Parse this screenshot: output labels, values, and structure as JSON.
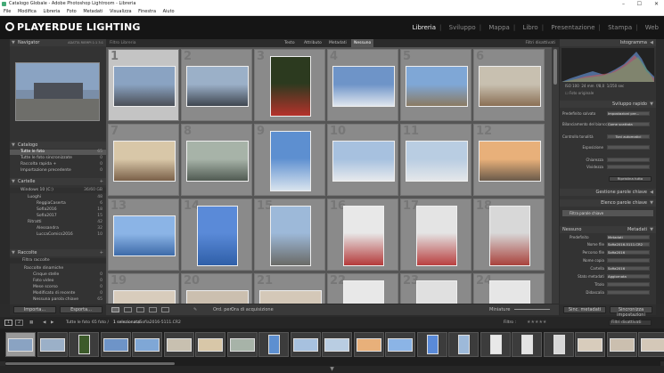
{
  "window": {
    "title": "Catalogo Globale - Adobe Photoshop Lightroom - Libreria",
    "min": "–",
    "max": "☐",
    "close": "✕"
  },
  "menu": [
    "File",
    "Modifica",
    "Libreria",
    "Foto",
    "Metadati",
    "Visualizza",
    "Finestra",
    "Aiuto"
  ],
  "logo": {
    "text": "PLAYERDUE LIGHTING"
  },
  "modules": [
    {
      "label": "Libreria",
      "active": true
    },
    {
      "label": "Sviluppo"
    },
    {
      "label": "Mappa"
    },
    {
      "label": "Libro"
    },
    {
      "label": "Presentazione"
    },
    {
      "label": "Stampa"
    },
    {
      "label": "Web"
    }
  ],
  "left": {
    "navigator": {
      "title": "Navigator",
      "opts": "ADATTA   RIEMPI   1:1   3:1"
    },
    "catalog": {
      "title": "Catalogo",
      "items": [
        {
          "label": "Tutte le foto",
          "count": "65",
          "selected": true
        },
        {
          "label": "Tutte le foto sincronizzate",
          "count": "0"
        },
        {
          "label": "Raccolta rapida +",
          "count": "0"
        },
        {
          "label": "Importazione precedente",
          "count": "0"
        }
      ]
    },
    "folders": {
      "title": "Cartelle",
      "drive": "Windows 10 (C:)",
      "drive_info": "36/60 GB",
      "items": [
        {
          "label": "Luoghi",
          "count": "48"
        },
        {
          "label": "ReggiaCaserta",
          "count": "6"
        },
        {
          "label": "Sofia2016",
          "count": "18"
        },
        {
          "label": "Sofia2017",
          "count": "15"
        },
        {
          "label": "Ritratti",
          "count": "42"
        },
        {
          "label": "Alessandra",
          "count": "32"
        },
        {
          "label": "LuccaComics2016",
          "count": "10"
        }
      ]
    },
    "collections": {
      "title": "Raccolte",
      "items": [
        {
          "label": "Filtra raccolte",
          "count": ""
        },
        {
          "label": "Raccolte dinamiche",
          "count": ""
        },
        {
          "label": "Cinque stelle",
          "count": "0"
        },
        {
          "label": "Foto video",
          "count": "0"
        },
        {
          "label": "Mese scorso",
          "count": "0"
        },
        {
          "label": "Modificato di recente",
          "count": "0"
        },
        {
          "label": "Nessuna parola chiave",
          "count": "65"
        }
      ]
    },
    "import": "Importa...",
    "export": "Esporta..."
  },
  "filter": {
    "label": "Filtro Libreria",
    "tabs": [
      "Testo",
      "Attributo",
      "Metadati",
      "Nessuno"
    ],
    "active": "Nessuno",
    "preset": "Filtri disattivati"
  },
  "toolbar": {
    "sort_label": "Ord. per:",
    "sort_value": "Ora di acquisizione",
    "thumb_label": "Miniature"
  },
  "right": {
    "histogram": {
      "title": "Istogramma",
      "iso": "ISO 100",
      "focal": "24 mm",
      "aperture": "f/8,0",
      "shutter": "1/250 sec",
      "original": "Foto originale"
    },
    "quick": {
      "title": "Sviluppo rapido",
      "rows": [
        {
          "label": "Predefinito salvato",
          "value": "Impostazioni pre..."
        },
        {
          "label": "Bilanciamento del bianco",
          "value": "Come scattata"
        },
        {
          "label": "Controllo tonalità",
          "value": "Toni automatici"
        },
        {
          "label": "Esposizione",
          "value": ""
        },
        {
          "label": "Chiarezza",
          "value": ""
        },
        {
          "label": "Vividezza",
          "value": ""
        }
      ],
      "reset": "Ripristina tutto"
    },
    "keywording": {
      "title": "Gestione parole chiave"
    },
    "keywordlist": {
      "title": "Elenco parole chiave",
      "filter": "Filtra parole chiave"
    },
    "metadata": {
      "title": "Metadati",
      "preset_label": "Impostazioni",
      "preset": "Nessuno",
      "default_label": "Predefinito",
      "default": "Metadati",
      "rows": [
        {
          "label": "Nome file",
          "value": "Sofia2016-5111.CR2"
        },
        {
          "label": "Percorso file",
          "value": "Sofia2016"
        },
        {
          "label": "Nome copia",
          "value": ""
        },
        {
          "label": "Cartella",
          "value": "Sofia2016"
        },
        {
          "label": "Stato metadati",
          "value": "Aggiornata"
        },
        {
          "label": "Titolo",
          "value": ""
        },
        {
          "label": "Didascalia",
          "value": ""
        }
      ]
    },
    "sync_meta": "Sinc. metadati",
    "sync_settings": "Sincronizza impostazioni"
  },
  "filmstrip": {
    "page1": "1",
    "page2": "2",
    "crumb": "Tutte le foto",
    "count": "65 foto /",
    "selected": "1 selezionata",
    "file": "/Sofia2016-5111.CR2",
    "filter_label": "Filtro :",
    "filter_value": "Filtri disattivati"
  },
  "grid_numbers": [
    "1",
    "2",
    "3",
    "4",
    "5",
    "6",
    "7",
    "8",
    "9",
    "10",
    "11",
    "12",
    "13",
    "14",
    "15",
    "16",
    "17",
    "18",
    "19",
    "20",
    "21",
    "22",
    "23",
    "24"
  ]
}
